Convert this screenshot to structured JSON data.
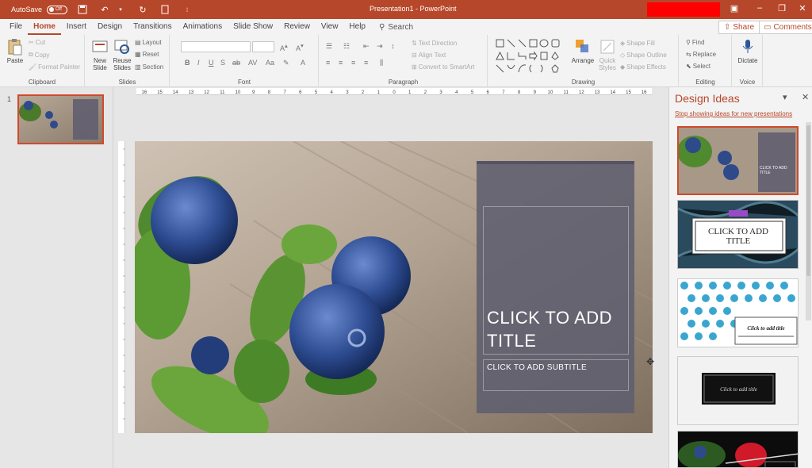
{
  "titlebar": {
    "autosave_label": "AutoSave",
    "autosave_state": "Off",
    "document_title": "Presentation1 - PowerPoint",
    "accent_color": "#b7472a"
  },
  "tabs": [
    "File",
    "Home",
    "Insert",
    "Design",
    "Transitions",
    "Animations",
    "Slide Show",
    "Review",
    "View",
    "Help"
  ],
  "active_tab": "Home",
  "search_label": "Search",
  "share_label": "Share",
  "comments_label": "Comments",
  "ribbon": {
    "clipboard": {
      "label": "Clipboard",
      "paste": "Paste",
      "cut": "Cut",
      "copy": "Copy",
      "format_painter": "Format Painter"
    },
    "slides": {
      "label": "Slides",
      "new_slide": "New Slide",
      "reuse_slides": "Reuse Slides",
      "layout": "Layout",
      "reset": "Reset",
      "section": "Section"
    },
    "font": {
      "label": "Font"
    },
    "paragraph": {
      "label": "Paragraph",
      "text_direction": "Text Direction",
      "align_text": "Align Text",
      "convert_smartart": "Convert to SmartArt"
    },
    "drawing": {
      "label": "Drawing",
      "arrange": "Arrange",
      "quick_styles": "Quick Styles",
      "shape_fill": "Shape Fill",
      "shape_outline": "Shape Outline",
      "shape_effects": "Shape Effects"
    },
    "editing": {
      "label": "Editing",
      "find": "Find",
      "replace": "Replace",
      "select": "Select"
    },
    "voice": {
      "label": "Voice",
      "dictate": "Dictate"
    }
  },
  "thumbnails": {
    "slide_number": "1"
  },
  "ruler_labels": [
    "16",
    "15",
    "14",
    "13",
    "12",
    "11",
    "10",
    "9",
    "8",
    "7",
    "6",
    "5",
    "4",
    "3",
    "2",
    "1",
    "0",
    "1",
    "2",
    "3",
    "4",
    "5",
    "6",
    "7",
    "8",
    "9",
    "10",
    "11",
    "12",
    "13",
    "14",
    "15",
    "16"
  ],
  "slide": {
    "title_placeholder": "CLICK TO ADD TITLE",
    "subtitle_placeholder": "CLICK TO ADD SUBTITLE"
  },
  "design_pane": {
    "title": "Design Ideas",
    "stop_link": "Stop showing ideas for new presentations",
    "ideas": [
      {
        "caption": "CLICK TO ADD TITLE"
      },
      {
        "caption": "CLICK TO ADD TITLE"
      },
      {
        "caption": "Click to add title"
      },
      {
        "caption": "Click to add title"
      }
    ]
  }
}
